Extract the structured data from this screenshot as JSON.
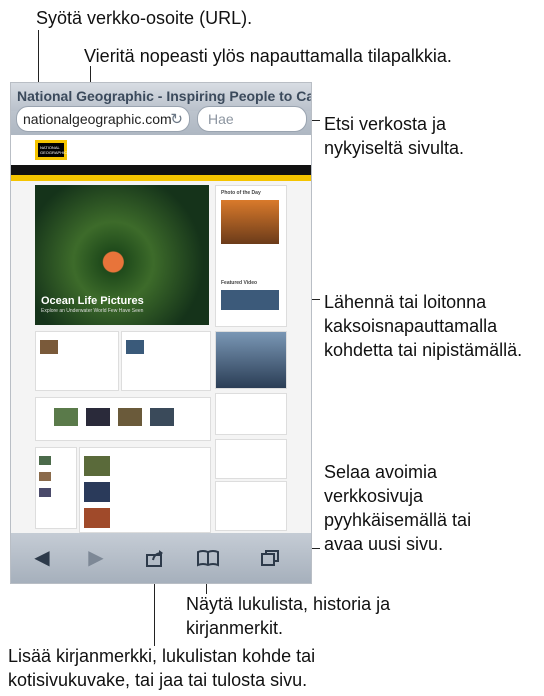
{
  "callouts": {
    "url": "Syötä verkko-osoite (URL).",
    "scroll_top": "Vieritä nopeasti ylös napauttamalla tilapalkkia.",
    "search": [
      "Etsi verkosta ja",
      "nykyiseltä sivulta."
    ],
    "zoom": [
      "Lähennä tai loitonna",
      "kaksoisnapauttamalla",
      "kohdetta tai nipistämällä."
    ],
    "pages": [
      "Selaa avoimia",
      "verkkosivuja",
      "pyyhkäisemällä tai",
      "avaa uusi sivu."
    ],
    "reading": [
      "Näytä lukulista, historia ja",
      "kirjanmerkit."
    ],
    "share": [
      "Lisää kirjanmerkki, lukulistan kohde tai",
      "kotisivukuvake, tai jaa tai tulosta sivu."
    ]
  },
  "browser": {
    "page_title": "National Geographic - Inspiring People to Care...",
    "url": "nationalgeographic.com",
    "search_placeholder": "Hae"
  },
  "site": {
    "logo": "NATIONAL GEOGRAPHIC",
    "hero_title": "Ocean Life Pictures",
    "hero_subtitle": "Explore an Underwater World Few Have Seen",
    "photo_of_day": "Photo of the Day",
    "featured_video": "Featured Video"
  },
  "toolbar": {
    "back_icon": "◀",
    "forward_icon": "▶",
    "share_icon": "share-icon",
    "bookmarks_icon": "book-icon",
    "pages_icon": "pages-icon"
  }
}
